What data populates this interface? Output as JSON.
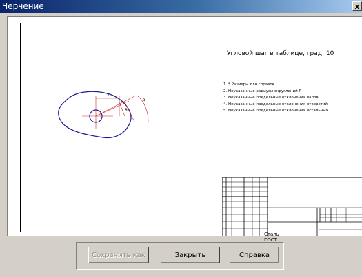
{
  "window": {
    "title": "Черчение",
    "close_glyph": "x"
  },
  "sheet": {
    "angle_step_note": "Угловой шаг в таблице, град: 10",
    "notes": [
      "1. * Размеры для справок",
      "2. Неуказанные радиусы скруглений R",
      "3. Неуказанные предельные отклонения валов",
      "4. Неуказанные предельные отклонения отверстий",
      "5. Неуказанные предельные отклонения остальных"
    ],
    "drawing_labels": {
      "x": "x",
      "r": "R",
      "a": "a"
    },
    "title_block": {
      "material": "Сталь",
      "standard": "ГОСТ"
    }
  },
  "buttons": {
    "save_as": {
      "label": "Сохранить как",
      "enabled": false
    },
    "close": {
      "label": "Закрыть"
    },
    "help": {
      "label": "Справка"
    }
  }
}
